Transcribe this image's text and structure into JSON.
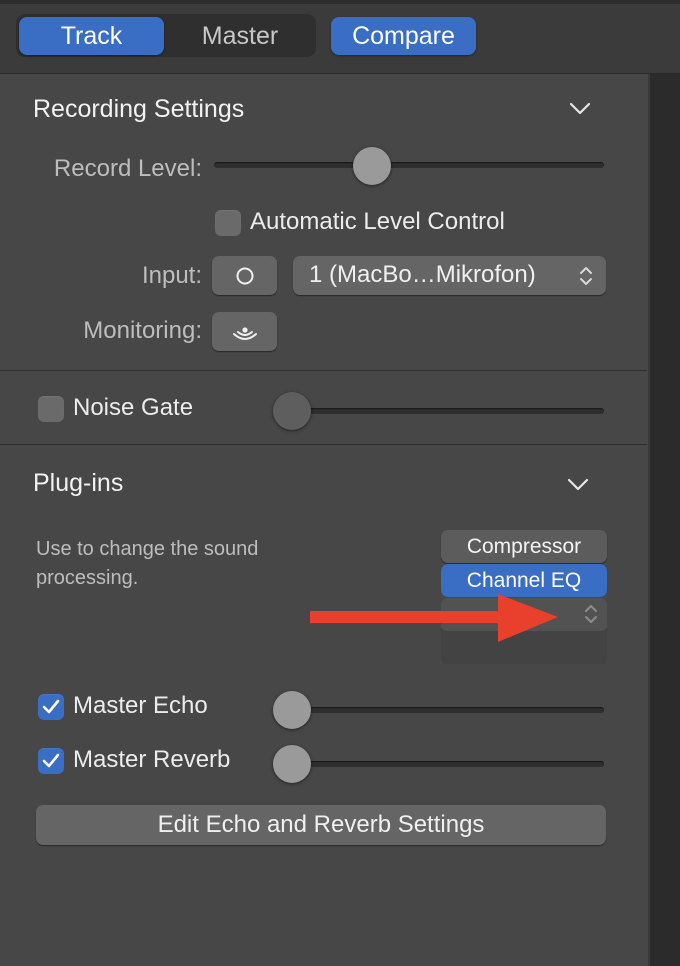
{
  "tabs": {
    "track": "Track",
    "master": "Master",
    "compare": "Compare"
  },
  "recording": {
    "title": "Recording Settings",
    "record_level_label": "Record Level:",
    "record_level_value": 0.41,
    "alc_label": "Automatic Level Control",
    "alc_checked": false,
    "input_label": "Input:",
    "input_format_icon": "mono-circle-icon",
    "input_source": "1  (MacBo…Mikrofon)",
    "monitoring_label": "Monitoring:",
    "monitoring_icon": "monitoring-waves-icon"
  },
  "noise_gate": {
    "label": "Noise Gate",
    "checked": false,
    "value": 0.0
  },
  "plugins": {
    "title": "Plug-ins",
    "description": "Use to change the sound processing.",
    "slots": [
      "Compressor",
      "Channel EQ",
      ""
    ]
  },
  "master_effects": {
    "echo_label": "Master Echo",
    "echo_checked": true,
    "echo_value": 0.0,
    "reverb_label": "Master Reverb",
    "reverb_checked": true,
    "reverb_value": 0.0,
    "edit_button": "Edit Echo and Reverb Settings"
  },
  "colors": {
    "accent": "#3a6dc4",
    "annotation_arrow": "#e8402a",
    "panel": "#474747"
  }
}
